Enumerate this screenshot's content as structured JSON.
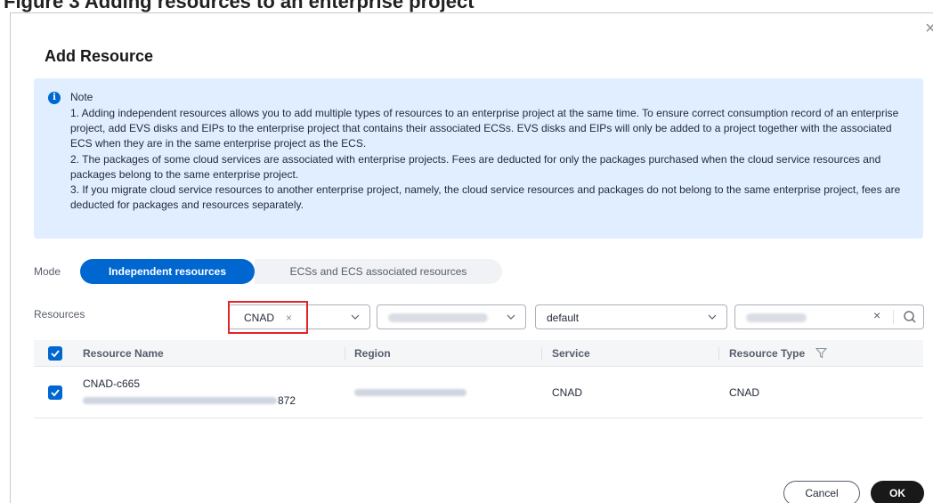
{
  "dialog": {
    "title": "Add Resource",
    "close_glyph": "×"
  },
  "caption": {
    "text": "Figure 3 Adding resources to an enterprise project"
  },
  "note": {
    "heading": "Note",
    "icon_glyph": "i",
    "lines": [
      "1. Adding independent resources allows you to add multiple types of resources to an enterprise project at the same time. To ensure correct consumption record of an enterprise project, add EVS disks and EIPs to the enterprise project that contains their associated ECSs. EVS disks and EIPs will only be added to a project together with the associated ECS when they are in the same enterprise project as the ECS.",
      "2. The packages of some cloud services are associated with enterprise projects. Fees are deducted for only the packages purchased when the cloud service resources and packages belong to the same enterprise project.",
      "3. If you migrate cloud service resources to another enterprise project, namely, the cloud service resources and packages do not belong to the same enterprise project, fees are deducted for packages and resources separately."
    ]
  },
  "mode": {
    "label": "Mode",
    "tabs": [
      {
        "label": "Independent resources",
        "active": true
      },
      {
        "label": "ECSs and ECS associated resources",
        "active": false
      }
    ]
  },
  "filters": {
    "label": "Resources",
    "service_chip": "CNAD",
    "chip_remove_glyph": "×",
    "project_value": "default",
    "search_clear_glyph": "×"
  },
  "table": {
    "headers": [
      "Resource Name",
      "Region",
      "Service",
      "Resource Type"
    ],
    "rows": [
      {
        "name": "CNAD-c665",
        "id_suffix": "872",
        "service": "CNAD",
        "resource_type": "CNAD",
        "checked": true
      }
    ]
  },
  "footer": {
    "cancel": "Cancel",
    "ok": "OK"
  },
  "colors": {
    "primary": "#0067d1",
    "note_bg": "#e0eeff",
    "highlight": "#e2242b",
    "ok_bg": "#191919"
  },
  "icons": [
    "info-icon",
    "close-icon",
    "chevron-down-icon",
    "search-icon",
    "filter-icon",
    "checkbox-checked-icon"
  ]
}
